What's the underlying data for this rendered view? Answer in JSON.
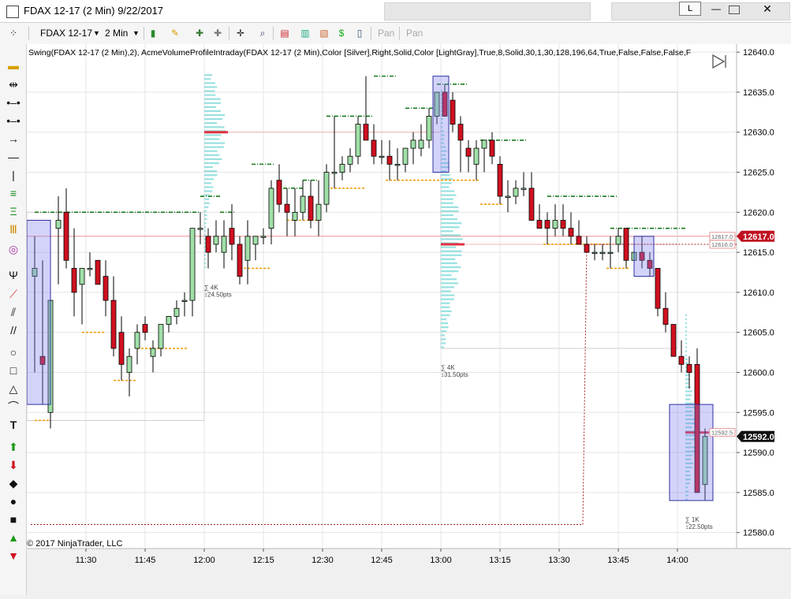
{
  "window": {
    "title": "FDAX 12-17 (2 Min)  9/22/2017",
    "language_button": "L",
    "minimize_icon": "minimize-icon",
    "maximize_icon": "maximize-icon",
    "close_icon": "close-icon"
  },
  "toolbar": {
    "instrument": "FDAX 12-17",
    "interval": "2 Min",
    "pan_label_1": "Pan",
    "pan_label_2": "Pan"
  },
  "indicator_label": "Swing(FDAX 12-17 (2 Min),2), AcmeVolumeProfileIntraday(FDAX 12-17 (2 Min),Color [Silver],Right,Solid,Color [LightGray],True,8,Solid,30,1,30,128,196,64,True,False,False,False,F",
  "copyright": "© 2017 NinjaTrader, LLC",
  "colors": {
    "up": "#a0e0a8",
    "down": "#d01020",
    "swing_high": "#1a7a1a",
    "swing_low": "#f0a010",
    "profile": "#8adcdc",
    "poc": "#e03040",
    "box": "#8080f0"
  },
  "chart_data": {
    "type": "candlestick",
    "ylim": [
      12578,
      12641
    ],
    "y_ticks": [
      12580.0,
      12585.0,
      12590.0,
      12595.0,
      12600.0,
      12605.0,
      12610.0,
      12615.0,
      12620.0,
      12625.0,
      12630.0,
      12635.0,
      12640.0
    ],
    "x_ticks": [
      {
        "t": 690,
        "label": "11:30"
      },
      {
        "t": 705,
        "label": "11:45"
      },
      {
        "t": 720,
        "label": "12:00"
      },
      {
        "t": 735,
        "label": "12:15"
      },
      {
        "t": 750,
        "label": "12:30"
      },
      {
        "t": 765,
        "label": "12:45"
      },
      {
        "t": 780,
        "label": "13:00"
      },
      {
        "t": 795,
        "label": "13:15"
      },
      {
        "t": 810,
        "label": "13:30"
      },
      {
        "t": 825,
        "label": "13:45"
      },
      {
        "t": 840,
        "label": "14:00"
      }
    ],
    "time_range": [
      675,
      855
    ],
    "last_price": "12592.0",
    "marker_price": "12617.0",
    "right_labels": [
      {
        "price": 12617.0,
        "text": "12617.0"
      },
      {
        "price": 12616.0,
        "text": "12616.0"
      },
      {
        "price": 12592.5,
        "text": "12592.5"
      }
    ],
    "candles_columns": [
      "t",
      "o",
      "h",
      "l",
      "c"
    ],
    "candles": [
      [
        677,
        12612,
        12617,
        12600,
        12613
      ],
      [
        679,
        12602,
        12614,
        12596,
        12601
      ],
      [
        681,
        12595,
        12619,
        12593,
        12609
      ],
      [
        683,
        12618,
        12622,
        12611,
        12619
      ],
      [
        685,
        12620,
        12623,
        12613,
        12614
      ],
      [
        687,
        12613,
        12618,
        12607,
        12610
      ],
      [
        689,
        12611,
        12613,
        12606,
        12613
      ],
      [
        691,
        12613,
        12615,
        12612,
        12613
      ],
      [
        693,
        12614,
        12614,
        12611,
        12611
      ],
      [
        695,
        12612,
        12614,
        12607,
        12609
      ],
      [
        697,
        12609,
        12612,
        12602,
        12603
      ],
      [
        699,
        12605,
        12607,
        12599,
        12601
      ],
      [
        701,
        12600,
        12603,
        12597,
        12602
      ],
      [
        703,
        12603,
        12606,
        12601,
        12605
      ],
      [
        705,
        12606,
        12607,
        12604,
        12605
      ],
      [
        707,
        12602,
        12604,
        12600,
        12603
      ],
      [
        709,
        12603,
        12606,
        12602,
        12606
      ],
      [
        711,
        12606,
        12607,
        12605,
        12607
      ],
      [
        713,
        12607,
        12609,
        12606,
        12608
      ],
      [
        715,
        12609,
        12610,
        12607,
        12609
      ],
      [
        717,
        12609,
        12618,
        12607,
        12618
      ],
      [
        719,
        12618,
        12620,
        12616,
        12618
      ],
      [
        721,
        12617,
        12618,
        12613,
        12615
      ],
      [
        723,
        12616,
        12619,
        12615,
        12617
      ],
      [
        725,
        12615,
        12619,
        12613,
        12617
      ],
      [
        727,
        12618,
        12621,
        12614,
        12616
      ],
      [
        729,
        12616,
        12617,
        12611,
        12612
      ],
      [
        731,
        12614,
        12619,
        12611,
        12617
      ],
      [
        733,
        12616,
        12617,
        12614,
        12617
      ],
      [
        735,
        12617,
        12618,
        12616,
        12617
      ],
      [
        737,
        12618,
        12624,
        12616,
        12623
      ],
      [
        739,
        12624,
        12626,
        12620,
        12621
      ],
      [
        741,
        12621,
        12623,
        12617,
        12620
      ],
      [
        743,
        12619,
        12623,
        12617,
        12620
      ],
      [
        745,
        12620,
        12624,
        12619,
        12622
      ],
      [
        747,
        12622,
        12624,
        12618,
        12619
      ],
      [
        749,
        12619,
        12624,
        12617,
        12621
      ],
      [
        751,
        12621,
        12626,
        12620,
        12625
      ],
      [
        753,
        12625,
        12632,
        12623,
        12625
      ],
      [
        755,
        12625,
        12627,
        12624,
        12626
      ],
      [
        757,
        12626,
        12628,
        12625,
        12627
      ],
      [
        759,
        12627,
        12632,
        12626,
        12631
      ],
      [
        761,
        12631,
        12637,
        12629,
        12629
      ],
      [
        763,
        12629,
        12631,
        12626,
        12627
      ],
      [
        765,
        12627,
        12629,
        12626,
        12627
      ],
      [
        767,
        12627,
        12629,
        12624,
        12626
      ],
      [
        769,
        12626,
        12628,
        12624,
        12626
      ],
      [
        771,
        12626,
        12628,
        12625,
        12628
      ],
      [
        773,
        12628,
        12630,
        12626,
        12629
      ],
      [
        775,
        12628,
        12631,
        12627,
        12629
      ],
      [
        777,
        12629,
        12633,
        12628,
        12632
      ],
      [
        779,
        12632,
        12635,
        12631,
        12635
      ],
      [
        781,
        12635,
        12636,
        12632,
        12632
      ],
      [
        783,
        12634,
        12635,
        12630,
        12631
      ],
      [
        785,
        12631,
        12632,
        12625,
        12629
      ],
      [
        787,
        12628,
        12629,
        12625,
        12627
      ],
      [
        789,
        12626,
        12629,
        12624,
        12628
      ],
      [
        791,
        12628,
        12629,
        12625,
        12629
      ],
      [
        793,
        12629,
        12630,
        12626,
        12627
      ],
      [
        795,
        12626,
        12627,
        12621,
        12622
      ],
      [
        797,
        12622,
        12624,
        12620,
        12622
      ],
      [
        799,
        12622,
        12624,
        12621,
        12623
      ],
      [
        801,
        12623,
        12625,
        12622,
        12623
      ],
      [
        803,
        12623,
        12625,
        12619,
        12619
      ],
      [
        805,
        12619,
        12621,
        12618,
        12618
      ],
      [
        807,
        12619,
        12620,
        12616,
        12618
      ],
      [
        809,
        12618,
        12621,
        12617,
        12619
      ],
      [
        811,
        12619,
        12621,
        12617,
        12618
      ],
      [
        813,
        12618,
        12620,
        12616,
        12617
      ],
      [
        815,
        12617,
        12619,
        12616,
        12616
      ],
      [
        817,
        12616,
        12617,
        12615,
        12615
      ],
      [
        819,
        12615,
        12616,
        12614,
        12615
      ],
      [
        821,
        12615,
        12616,
        12614,
        12615
      ],
      [
        823,
        12615,
        12617,
        12613,
        12615
      ],
      [
        825,
        12616,
        12618,
        12615,
        12617
      ],
      [
        827,
        12618,
        12618,
        12613,
        12614
      ],
      [
        829,
        12614,
        12616,
        12613,
        12615
      ],
      [
        831,
        12615,
        12617,
        12613,
        12614
      ],
      [
        833,
        12614,
        12615,
        12612,
        12613
      ],
      [
        835,
        12613,
        12613,
        12607,
        12608
      ],
      [
        837,
        12608,
        12610,
        12605,
        12606
      ],
      [
        839,
        12606,
        12606,
        12602,
        12602
      ],
      [
        841,
        12602,
        12604,
        12600,
        12601
      ],
      [
        843,
        12601,
        12602,
        12598,
        12600
      ],
      [
        845,
        12601,
        12603,
        12585,
        12585
      ],
      [
        847,
        12586,
        12593,
        12584,
        12592
      ]
    ],
    "swing_highs": [
      {
        "t0": 677,
        "t1": 719,
        "price": 12620
      },
      {
        "t0": 719,
        "t1": 724,
        "price": 12622
      },
      {
        "t0": 724,
        "t1": 728,
        "price": 12620
      },
      {
        "t0": 732,
        "t1": 738,
        "price": 12626
      },
      {
        "t0": 740,
        "t1": 745,
        "price": 12623
      },
      {
        "t0": 745,
        "t1": 749,
        "price": 12624
      },
      {
        "t0": 751,
        "t1": 757,
        "price": 12632
      },
      {
        "t0": 757,
        "t1": 763,
        "price": 12632
      },
      {
        "t0": 763,
        "t1": 769,
        "price": 12637
      },
      {
        "t0": 771,
        "t1": 779,
        "price": 12633
      },
      {
        "t0": 779,
        "t1": 787,
        "price": 12636
      },
      {
        "t0": 790,
        "t1": 802,
        "price": 12629
      },
      {
        "t0": 807,
        "t1": 825,
        "price": 12622
      },
      {
        "t0": 823,
        "t1": 842,
        "price": 12618
      }
    ],
    "swing_lows": [
      {
        "t0": 677,
        "t1": 681,
        "price": 12594
      },
      {
        "t0": 689,
        "t1": 695,
        "price": 12605
      },
      {
        "t0": 697,
        "t1": 703,
        "price": 12599
      },
      {
        "t0": 703,
        "t1": 716,
        "price": 12603
      },
      {
        "t0": 729,
        "t1": 737,
        "price": 12613
      },
      {
        "t0": 741,
        "t1": 749,
        "price": 12619
      },
      {
        "t0": 751,
        "t1": 761,
        "price": 12623
      },
      {
        "t0": 766,
        "t1": 790,
        "price": 12624
      },
      {
        "t0": 790,
        "t1": 796,
        "price": 12621
      },
      {
        "t0": 806,
        "t1": 823,
        "price": 12616
      },
      {
        "t0": 822,
        "t1": 828,
        "price": 12613
      }
    ],
    "sessions": [
      {
        "t0": 720,
        "t1": 780,
        "top": 12637,
        "bottom": 12613,
        "poc": 12630,
        "stats": [
          "∑ 4K",
          "↕24.50pts"
        ]
      },
      {
        "t0": 780,
        "t1": 840,
        "top": 12635,
        "bottom": 12603,
        "poc": 12616,
        "stats": [
          "∑ 4K",
          "↕31.50pts"
        ]
      },
      {
        "t0": 842,
        "t1": 848,
        "top": 12607,
        "bottom": 12584,
        "poc": 12592.5,
        "stats": [
          "∑ 1K",
          "↕22.50pts"
        ]
      }
    ],
    "swing_boxes": [
      {
        "t0": 675,
        "t1": 681,
        "top": 12619,
        "bottom": 12596
      },
      {
        "t0": 778,
        "t1": 782,
        "top": 12637,
        "bottom": 12625
      },
      {
        "t0": 829,
        "t1": 834,
        "top": 12617,
        "bottom": 12612
      },
      {
        "t0": 838,
        "t1": 849,
        "top": 12596,
        "bottom": 12584
      }
    ],
    "grey_boxes": [
      {
        "t0": 675,
        "t1": 720,
        "top": 12620,
        "bottom": 12594
      },
      {
        "t0": 780,
        "t1": 840,
        "top": 12635,
        "bottom": 12603
      }
    ],
    "stop_line": {
      "t0": 676,
      "t1": 816,
      "t2": 817,
      "price": 12581,
      "price2": 12616
    }
  }
}
